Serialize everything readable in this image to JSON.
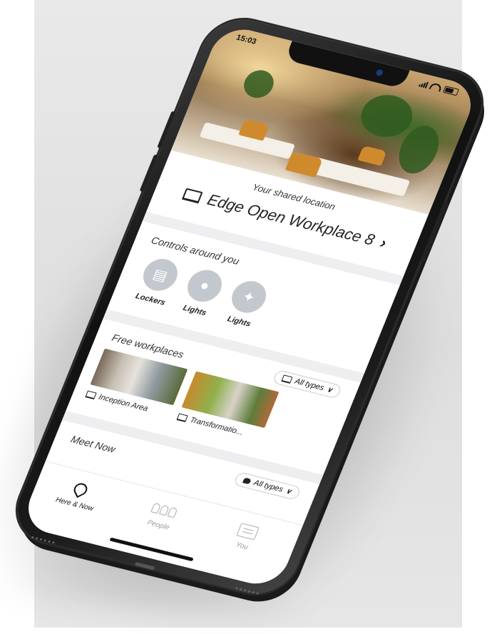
{
  "status_bar": {
    "time": "15:03"
  },
  "location": {
    "caption": "Your shared location",
    "name": "Edge Open Workplace 8",
    "icon": "laptop-icon"
  },
  "controls": {
    "title": "Controls around you",
    "items": [
      {
        "label": "Lockers",
        "icon": "locker-icon"
      },
      {
        "label": "Lights",
        "icon": "bulb-icon"
      },
      {
        "label": "Lights",
        "icon": "light-icon"
      }
    ]
  },
  "free_workplaces": {
    "title": "Free workplaces",
    "filter_label": "All types",
    "items": [
      {
        "label": "Inception Area",
        "icon": "laptop-icon"
      },
      {
        "label": "Transformatio...",
        "icon": "laptop-icon"
      }
    ]
  },
  "meet_now": {
    "title": "Meet Now",
    "filter_label": "All types"
  },
  "tabs": [
    {
      "label": "Here & Now",
      "icon": "pin-icon",
      "active": true
    },
    {
      "label": "People",
      "icon": "people-icon",
      "active": false
    },
    {
      "label": "You",
      "icon": "id-card-icon",
      "active": false
    }
  ],
  "colors": {
    "accent": "#111111",
    "control_circle": "#c3c8ce",
    "section_divider": "#eeeef0"
  }
}
